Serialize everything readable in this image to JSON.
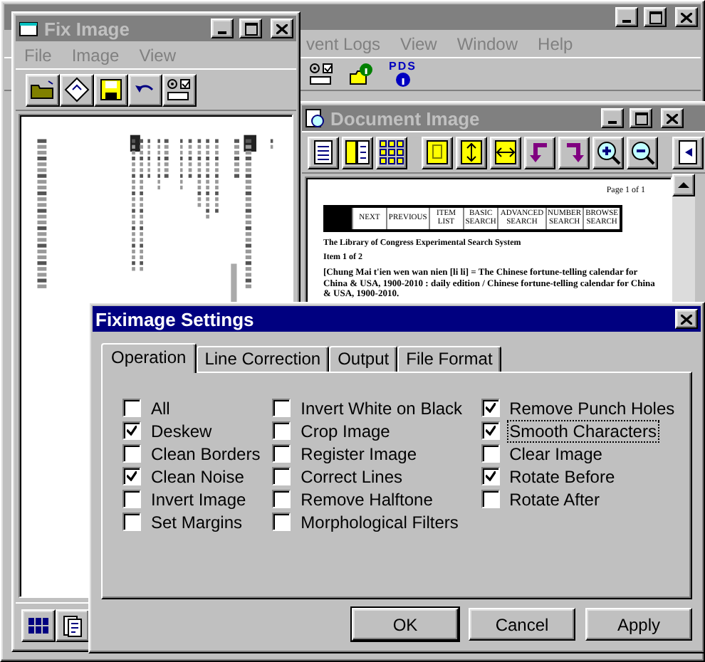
{
  "app_window": {
    "menu": [
      {
        "label": "vent Logs",
        "disabled": true
      },
      {
        "label": "View",
        "disabled": true
      },
      {
        "label": "Window",
        "disabled": true
      },
      {
        "label": "Help",
        "disabled": true
      }
    ],
    "toolbar_badge": "PDS"
  },
  "fix_image_window": {
    "title": "Fix Image",
    "active": false,
    "menu": [
      {
        "label": "File",
        "disabled": true
      },
      {
        "label": "Image",
        "disabled": true
      },
      {
        "label": "View",
        "disabled": true
      }
    ]
  },
  "document_window": {
    "title": "Document Image",
    "active": false,
    "page": {
      "page_number": "Page 1 of 1",
      "nav_buttons": [
        "NEXT",
        "PREVIOUS",
        "ITEM LIST",
        "BASIC SEARCH",
        "ADVANCED SEARCH",
        "NUMBER SEARCH",
        "BROWSE SEARCH"
      ],
      "system_name": "The Library of Congress Experimental Search System",
      "item_count": "Item 1 of 2",
      "record": "[Chung Mai t'ien wen wan nien [li li] = The Chinese fortune-telling calendar for China & USA, 1900-2010 : daily edition / Chinese fortune-telling calendar for China & USA, 1900-2010."
    }
  },
  "settings_dialog": {
    "title": "Fiximage Settings",
    "active": true,
    "tabs": [
      {
        "label": "Operation",
        "selected": true
      },
      {
        "label": "Line Correction",
        "selected": false
      },
      {
        "label": "Output",
        "selected": false
      },
      {
        "label": "File Format",
        "selected": false
      }
    ],
    "option_columns": [
      [
        {
          "label": "All",
          "checked": false,
          "focused": false
        },
        {
          "label": "Deskew",
          "checked": true,
          "focused": false
        },
        {
          "label": "Clean Borders",
          "checked": false,
          "focused": false
        },
        {
          "label": "Clean Noise",
          "checked": true,
          "focused": false
        },
        {
          "label": "Invert Image",
          "checked": false,
          "focused": false
        },
        {
          "label": "Set Margins",
          "checked": false,
          "focused": false
        }
      ],
      [
        {
          "label": "Invert White on Black",
          "checked": false,
          "focused": false
        },
        {
          "label": "Crop Image",
          "checked": false,
          "focused": false
        },
        {
          "label": "Register Image",
          "checked": false,
          "focused": false
        },
        {
          "label": "Correct Lines",
          "checked": false,
          "focused": false
        },
        {
          "label": "Remove Halftone",
          "checked": false,
          "focused": false
        },
        {
          "label": "Morphological Filters",
          "checked": false,
          "focused": false
        }
      ],
      [
        {
          "label": "Remove Punch Holes",
          "checked": true,
          "focused": false
        },
        {
          "label": "Smooth Characters",
          "checked": true,
          "focused": true
        },
        {
          "label": "Clear Image",
          "checked": false,
          "focused": false
        },
        {
          "label": "Rotate Before",
          "checked": true,
          "focused": false
        },
        {
          "label": "Rotate After",
          "checked": false,
          "focused": false
        }
      ]
    ],
    "buttons": [
      {
        "label": "OK",
        "default": true
      },
      {
        "label": "Cancel",
        "default": false
      },
      {
        "label": "Apply",
        "default": false
      }
    ]
  }
}
